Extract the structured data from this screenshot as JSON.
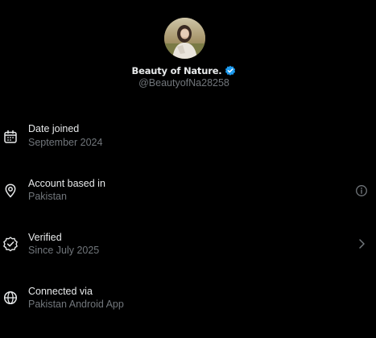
{
  "profile": {
    "display_name": "Beauty of Nature.",
    "handle": "@BeautyofNa28258",
    "verified": true,
    "avatar_icon": "profile-photo",
    "badge_color": "#1d9bf0"
  },
  "about": {
    "rows": [
      {
        "icon": "calendar-icon",
        "title": "Date joined",
        "subtitle": "September 2024"
      },
      {
        "icon": "location-pin-icon",
        "title": "Account based in",
        "subtitle": "Pakistan",
        "trailing_icon": "info-icon"
      },
      {
        "icon": "verified-check-icon",
        "title": "Verified",
        "subtitle": "Since July 2025",
        "trailing_icon": "chevron-right-icon"
      },
      {
        "icon": "globe-icon",
        "title": "Connected via",
        "subtitle": "Pakistan Android App"
      }
    ]
  },
  "colors": {
    "background": "#000000",
    "primary_text": "#e7e9ea",
    "secondary_text": "#71767b",
    "accent": "#1d9bf0"
  }
}
